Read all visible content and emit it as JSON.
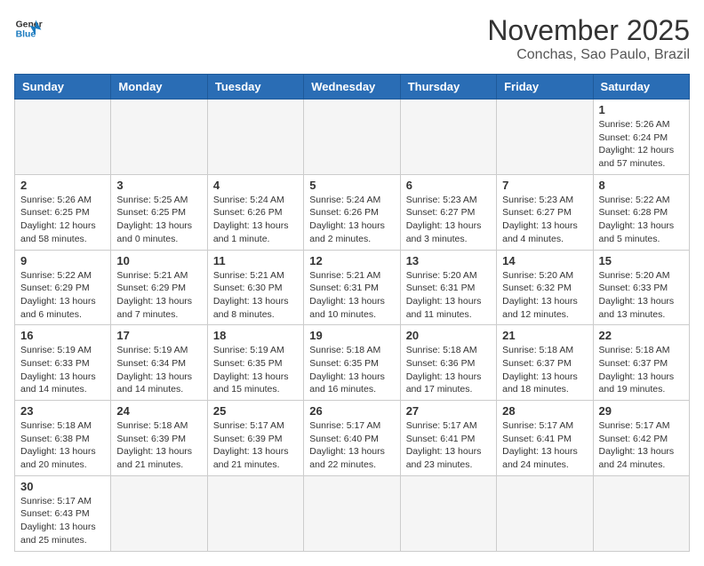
{
  "header": {
    "logo_line1": "General",
    "logo_line2": "Blue",
    "month_title": "November 2025",
    "location": "Conchas, Sao Paulo, Brazil"
  },
  "weekdays": [
    "Sunday",
    "Monday",
    "Tuesday",
    "Wednesday",
    "Thursday",
    "Friday",
    "Saturday"
  ],
  "days": {
    "1": {
      "sunrise": "5:26 AM",
      "sunset": "6:24 PM",
      "daylight": "12 hours and 57 minutes."
    },
    "2": {
      "sunrise": "5:26 AM",
      "sunset": "6:25 PM",
      "daylight": "12 hours and 58 minutes."
    },
    "3": {
      "sunrise": "5:25 AM",
      "sunset": "6:25 PM",
      "daylight": "13 hours and 0 minutes."
    },
    "4": {
      "sunrise": "5:24 AM",
      "sunset": "6:26 PM",
      "daylight": "13 hours and 1 minute."
    },
    "5": {
      "sunrise": "5:24 AM",
      "sunset": "6:26 PM",
      "daylight": "13 hours and 2 minutes."
    },
    "6": {
      "sunrise": "5:23 AM",
      "sunset": "6:27 PM",
      "daylight": "13 hours and 3 minutes."
    },
    "7": {
      "sunrise": "5:23 AM",
      "sunset": "6:27 PM",
      "daylight": "13 hours and 4 minutes."
    },
    "8": {
      "sunrise": "5:22 AM",
      "sunset": "6:28 PM",
      "daylight": "13 hours and 5 minutes."
    },
    "9": {
      "sunrise": "5:22 AM",
      "sunset": "6:29 PM",
      "daylight": "13 hours and 6 minutes."
    },
    "10": {
      "sunrise": "5:21 AM",
      "sunset": "6:29 PM",
      "daylight": "13 hours and 7 minutes."
    },
    "11": {
      "sunrise": "5:21 AM",
      "sunset": "6:30 PM",
      "daylight": "13 hours and 8 minutes."
    },
    "12": {
      "sunrise": "5:21 AM",
      "sunset": "6:31 PM",
      "daylight": "13 hours and 10 minutes."
    },
    "13": {
      "sunrise": "5:20 AM",
      "sunset": "6:31 PM",
      "daylight": "13 hours and 11 minutes."
    },
    "14": {
      "sunrise": "5:20 AM",
      "sunset": "6:32 PM",
      "daylight": "13 hours and 12 minutes."
    },
    "15": {
      "sunrise": "5:20 AM",
      "sunset": "6:33 PM",
      "daylight": "13 hours and 13 minutes."
    },
    "16": {
      "sunrise": "5:19 AM",
      "sunset": "6:33 PM",
      "daylight": "13 hours and 14 minutes."
    },
    "17": {
      "sunrise": "5:19 AM",
      "sunset": "6:34 PM",
      "daylight": "13 hours and 14 minutes."
    },
    "18": {
      "sunrise": "5:19 AM",
      "sunset": "6:35 PM",
      "daylight": "13 hours and 15 minutes."
    },
    "19": {
      "sunrise": "5:18 AM",
      "sunset": "6:35 PM",
      "daylight": "13 hours and 16 minutes."
    },
    "20": {
      "sunrise": "5:18 AM",
      "sunset": "6:36 PM",
      "daylight": "13 hours and 17 minutes."
    },
    "21": {
      "sunrise": "5:18 AM",
      "sunset": "6:37 PM",
      "daylight": "13 hours and 18 minutes."
    },
    "22": {
      "sunrise": "5:18 AM",
      "sunset": "6:37 PM",
      "daylight": "13 hours and 19 minutes."
    },
    "23": {
      "sunrise": "5:18 AM",
      "sunset": "6:38 PM",
      "daylight": "13 hours and 20 minutes."
    },
    "24": {
      "sunrise": "5:18 AM",
      "sunset": "6:39 PM",
      "daylight": "13 hours and 21 minutes."
    },
    "25": {
      "sunrise": "5:17 AM",
      "sunset": "6:39 PM",
      "daylight": "13 hours and 21 minutes."
    },
    "26": {
      "sunrise": "5:17 AM",
      "sunset": "6:40 PM",
      "daylight": "13 hours and 22 minutes."
    },
    "27": {
      "sunrise": "5:17 AM",
      "sunset": "6:41 PM",
      "daylight": "13 hours and 23 minutes."
    },
    "28": {
      "sunrise": "5:17 AM",
      "sunset": "6:41 PM",
      "daylight": "13 hours and 24 minutes."
    },
    "29": {
      "sunrise": "5:17 AM",
      "sunset": "6:42 PM",
      "daylight": "13 hours and 24 minutes."
    },
    "30": {
      "sunrise": "5:17 AM",
      "sunset": "6:43 PM",
      "daylight": "13 hours and 25 minutes."
    }
  }
}
